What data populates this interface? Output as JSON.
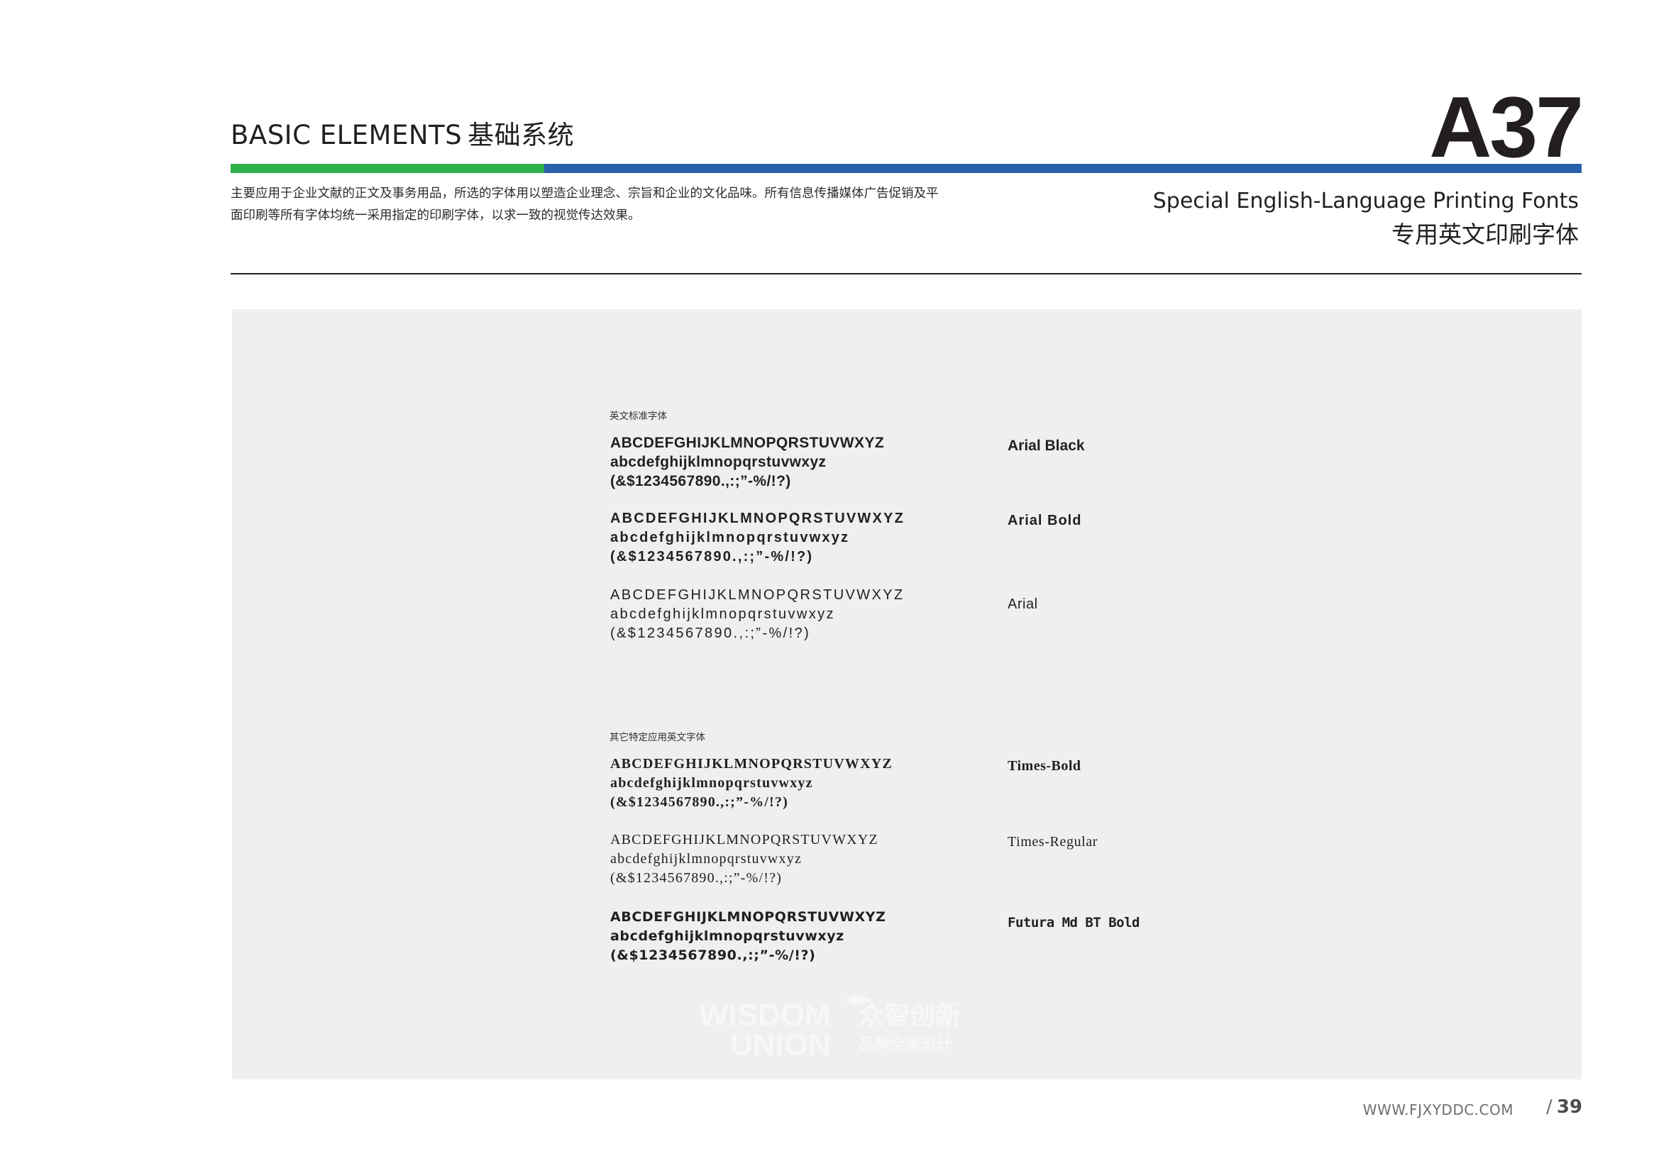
{
  "header": {
    "section_en": "BASIC ELEMENTS",
    "section_zh": "基础系统",
    "page_code": "A37",
    "colors": {
      "green": "#2fb14a",
      "blue": "#2b61ab"
    },
    "description": [
      "主要应用于企业文献的正文及事务用品，所选的字体用以塑造企业理念、宗旨和企业的文化品味。所有信息传播媒体广告促销及平",
      "面印刷等所有字体均统一采用指定的印刷字体，以求一致的视觉传达效果。"
    ],
    "title_en": "Special English-Language Printing Fonts",
    "title_zh": "专用英文印刷字体"
  },
  "groups": [
    {
      "label": "英文标准字体",
      "fonts": [
        {
          "name": "Arial Black",
          "lines": [
            "ABCDEFGHIJKLMNOPQRSTUVWXYZ",
            "abcdefghijklmnopqrstuvwxyz",
            "(&$1234567890.,:;”-%/!?)"
          ]
        },
        {
          "name": "Arial Bold",
          "lines": [
            "ABCDEFGHIJKLMNOPQRSTUVWXYZ",
            "abcdefghijklmnopqrstuvwxyz",
            "(&$1234567890.,:;”-%/!?)"
          ]
        },
        {
          "name": "Arial",
          "lines": [
            "ABCDEFGHIJKLMNOPQRSTUVWXYZ",
            "abcdefghijklmnopqrstuvwxyz",
            "(&$1234567890.,:;”-%/!?)"
          ]
        }
      ]
    },
    {
      "label": "其它特定应用英文字体",
      "fonts": [
        {
          "name": "Times-Bold",
          "lines": [
            "ABCDEFGHIJKLMNOPQRSTUVWXYZ",
            "abcdefghijklmnopqrstuvwxyz",
            "(&$1234567890.,:;”-%/!?)"
          ]
        },
        {
          "name": "Times-Regular",
          "lines": [
            "ABCDEFGHIJKLMNOPQRSTUVWXYZ",
            "abcdefghijklmnopqrstuvwxyz",
            "(&$1234567890.,:;”-%/!?)"
          ]
        },
        {
          "name": "Futura Md BT Bold",
          "lines": [
            "ABCDEFGHIJKLMNOPQRSTUVWXYZ",
            "abcdefghijklmnopqrstuvwxyz",
            "(&$1234567890.,:;”-%/!?)"
          ]
        }
      ]
    }
  ],
  "watermark": {
    "line1": "WISDOM",
    "line2": "UNION",
    "zh1": "众智创新",
    "zh2": "品牌全案设计"
  },
  "footer": {
    "url": "WWW.FJXYDDC.COM",
    "slash": "/",
    "page_number": "39"
  }
}
